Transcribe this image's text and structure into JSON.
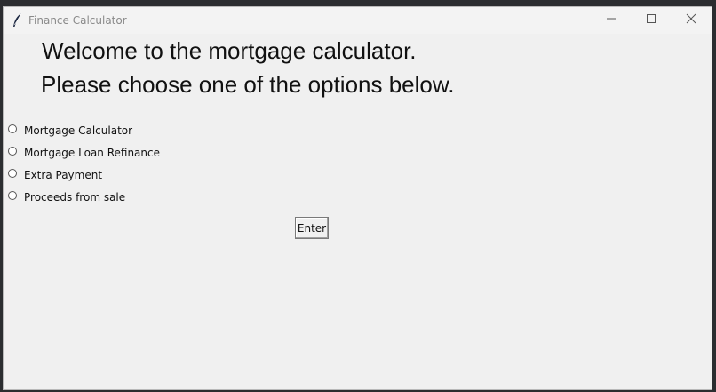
{
  "window": {
    "title": "Finance Calculator"
  },
  "welcome": {
    "line1": "Welcome to the mortgage calculator.",
    "line2": "Please choose one of the options below."
  },
  "options": [
    {
      "label": "Mortgage Calculator",
      "selected": false
    },
    {
      "label": "Mortgage Loan Refinance",
      "selected": false
    },
    {
      "label": "Extra Payment",
      "selected": false
    },
    {
      "label": "Proceeds from sale",
      "selected": false
    }
  ],
  "enter_button": {
    "label": "Enter"
  },
  "icons": {
    "app": "feather-icon",
    "minimize": "minimize-icon",
    "maximize": "maximize-icon",
    "close": "close-icon"
  }
}
